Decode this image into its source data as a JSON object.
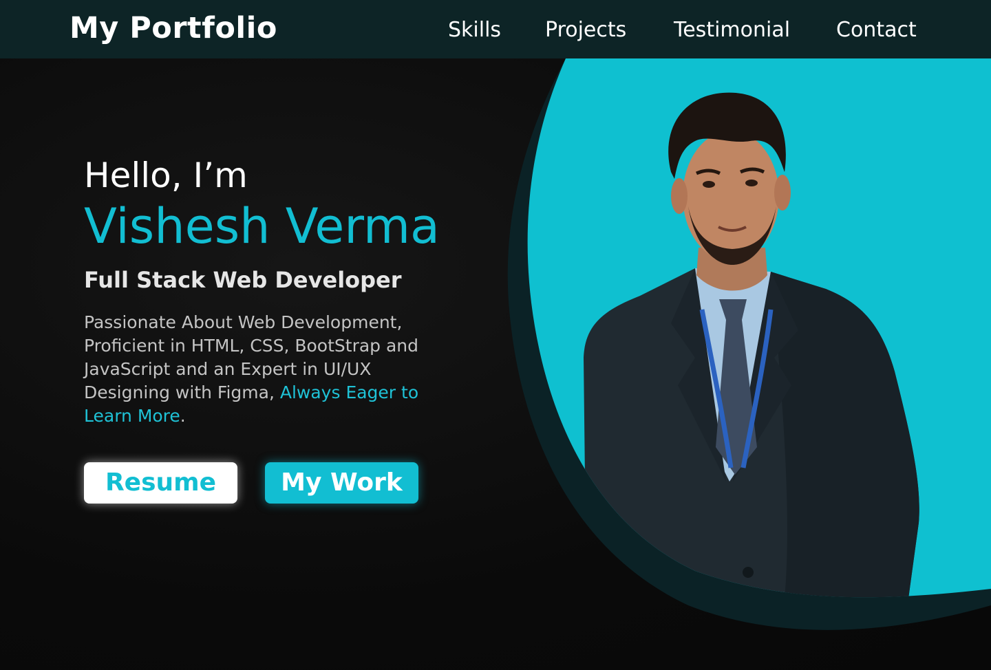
{
  "header": {
    "brand": "My Portfolio",
    "nav": [
      "Skills",
      "Projects",
      "Testimonial",
      "Contact"
    ]
  },
  "hero": {
    "greeting": "Hello, I’m",
    "name": "Vishesh Verma",
    "role": "Full Stack Web Developer",
    "intro_plain": "Passionate About Web Development, Proficient in HTML, CSS, BootStrap and JavaScript and an Expert in UI/UX Designing with Figma, ",
    "intro_accent": "Always Eager to Learn More",
    "intro_end": ".",
    "buttons": {
      "resume": "Resume",
      "work": "My Work"
    }
  },
  "colors": {
    "accent": "#12bed2",
    "header_bg": "#0d2426",
    "page_bg": "#0b0b0b",
    "blob_dark": "#0b2226"
  },
  "icons": {
    "portrait": "person-in-suit-photo"
  }
}
